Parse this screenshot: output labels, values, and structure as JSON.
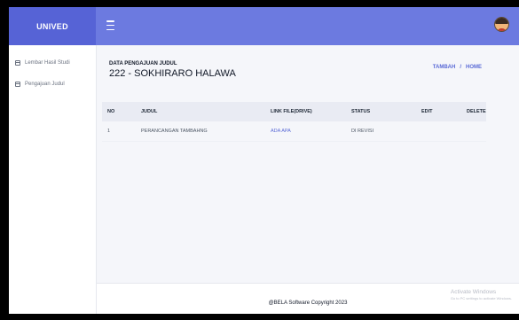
{
  "brand": "UNIVED",
  "sidebar": {
    "items": [
      {
        "label": "Lembar Hasil Studi",
        "icon": "calendar-icon"
      },
      {
        "label": "Pengajuan Judul",
        "icon": "calendar-icon"
      }
    ]
  },
  "header": {
    "subtitle": "DATA PENGAJUAN JUDUL",
    "title": "222 - SOKHIRARO HALAWA"
  },
  "breadcrumb": {
    "items": [
      "TAMBAH",
      "HOME"
    ],
    "separator": "/"
  },
  "table": {
    "columns": [
      "NO",
      "JUDUL",
      "LINK FILE(DRIVE)",
      "STATUS",
      "EDIT",
      "DELETE"
    ],
    "rows": [
      [
        "1",
        "PERANCANGAN TAMBAHNG",
        "ADA APA",
        "DI REVISI",
        "",
        ""
      ]
    ]
  },
  "footer": {
    "copyright": "@BELA Software Copyright 2023"
  },
  "watermark": {
    "title": "Activate Windows",
    "subtitle": "Go to PC settings to activate Windows."
  },
  "colors": {
    "topbar": "#6c7ae0",
    "brand_bg": "#5663d6",
    "accent_link": "#5a6ad6"
  }
}
